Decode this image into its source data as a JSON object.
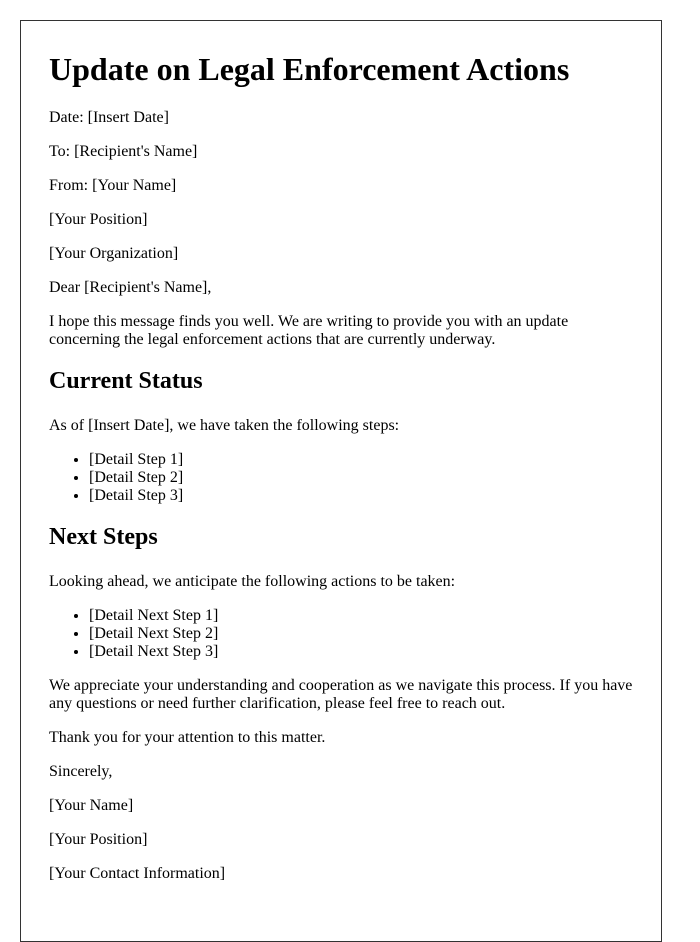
{
  "letter": {
    "title": "Update on Legal Enforcement Actions",
    "header_lines": [
      "Date: [Insert Date]",
      "To: [Recipient's Name]",
      "From: [Your Name]",
      "[Your Position]",
      "[Your Organization]"
    ],
    "salutation": "Dear [Recipient's Name],",
    "intro": "I hope this message finds you well. We are writing to provide you with an update concerning the legal enforcement actions that are currently underway.",
    "sections": [
      {
        "heading": "Current Status",
        "lead": "As of [Insert Date], we have taken the following steps:",
        "items": [
          "[Detail Step 1]",
          "[Detail Step 2]",
          "[Detail Step 3]"
        ]
      },
      {
        "heading": "Next Steps",
        "lead": "Looking ahead, we anticipate the following actions to be taken:",
        "items": [
          "[Detail Next Step 1]",
          "[Detail Next Step 2]",
          "[Detail Next Step 3]"
        ]
      }
    ],
    "closing_paragraph": "We appreciate your understanding and cooperation as we navigate this process. If you have any questions or need further clarification, please feel free to reach out.",
    "thanks": "Thank you for your attention to this matter.",
    "sign_off": "Sincerely,",
    "signature_lines": [
      "[Your Name]",
      "[Your Position]",
      "[Your Contact Information]"
    ]
  }
}
